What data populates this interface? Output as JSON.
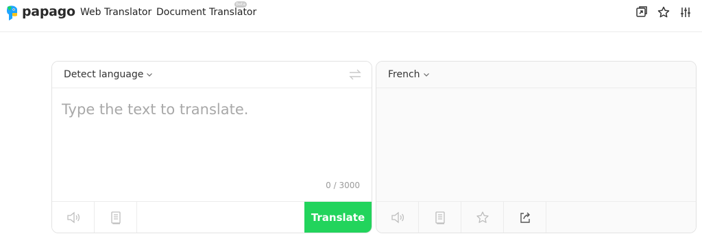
{
  "header": {
    "brand": "papago",
    "nav": {
      "web_translator": "Web Translator",
      "document_translator": "Document Translator",
      "beta_badge": "Beta"
    },
    "icons": [
      "popup-icon",
      "star-icon",
      "settings-sliders-icon"
    ]
  },
  "source": {
    "language": "Detect language",
    "placeholder": "Type the text to translate.",
    "counter": "0 / 3000",
    "translate_button": "Translate"
  },
  "target": {
    "language": "French"
  },
  "colors": {
    "accent": "#22d45c",
    "logo_blue": "#1ea5ff",
    "logo_green": "#1ed45c",
    "logo_yellow": "#ffc51a"
  }
}
